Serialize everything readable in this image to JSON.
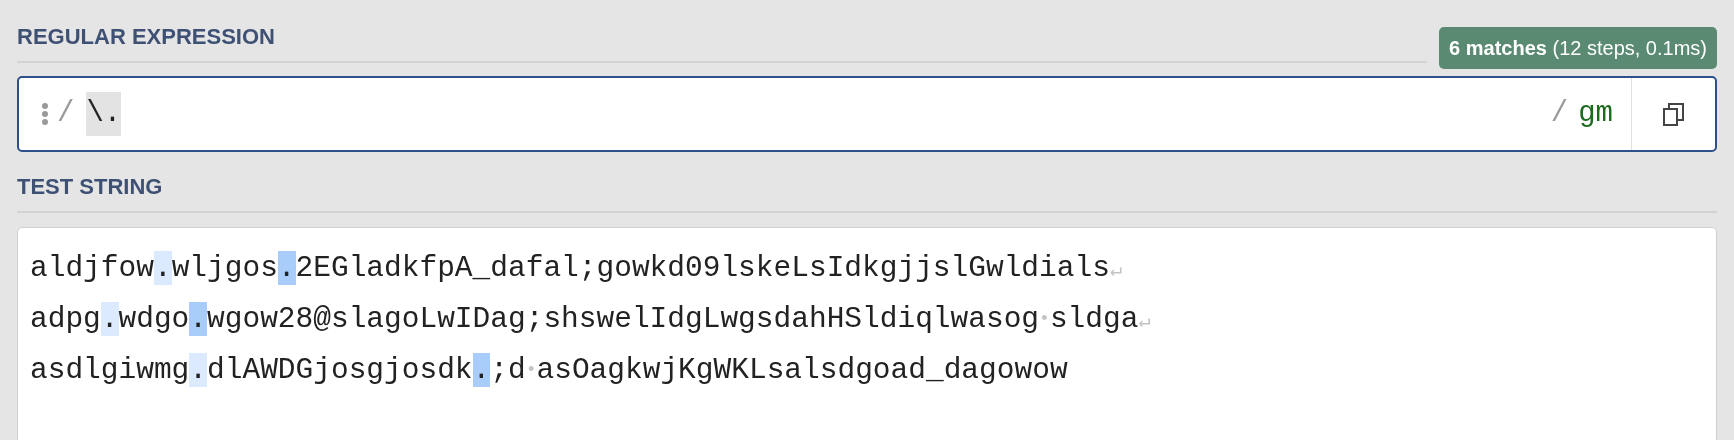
{
  "regex": {
    "heading": "REGULAR EXPRESSION",
    "badge": {
      "bold": "6 matches",
      "detail": "(12 steps, 0.1ms)"
    },
    "open_delimiter": "/",
    "pattern": "\\.",
    "close_delimiter": "/",
    "flags": "gm"
  },
  "test_string": {
    "heading": "TEST STRING",
    "lines": [
      [
        {
          "kind": "text",
          "text": "aldjfow"
        },
        {
          "kind": "match",
          "text": ".",
          "color": "#dbeafe"
        },
        {
          "kind": "text",
          "text": "wljgos"
        },
        {
          "kind": "match",
          "text": ".",
          "color": "#a8cdfa"
        },
        {
          "kind": "text",
          "text": "2EGladkfpA_dafal;gowkd09lskeLsIdkgjjslGwldials"
        },
        {
          "kind": "eol",
          "text": "↵"
        }
      ],
      [
        {
          "kind": "text",
          "text": "adpg"
        },
        {
          "kind": "match",
          "text": ".",
          "color": "#dbeafe"
        },
        {
          "kind": "text",
          "text": "wdgo"
        },
        {
          "kind": "match",
          "text": ".",
          "color": "#a8cdfa"
        },
        {
          "kind": "text",
          "text": "wgow28@slagoLwIDag;shswelIdgLwgsdahHSldiqlwasog"
        },
        {
          "kind": "space",
          "text": "•"
        },
        {
          "kind": "text",
          "text": "sldga"
        },
        {
          "kind": "eol",
          "text": "↵"
        }
      ],
      [
        {
          "kind": "text",
          "text": "asdlgiwmg"
        },
        {
          "kind": "match",
          "text": ".",
          "color": "#dbeafe"
        },
        {
          "kind": "text",
          "text": "dlAWDGjosgjosdk"
        },
        {
          "kind": "match",
          "text": ".",
          "color": "#a8cdfa"
        },
        {
          "kind": "text",
          "text": ";d"
        },
        {
          "kind": "space",
          "text": "•"
        },
        {
          "kind": "text",
          "text": "asOagkwjKgWKLsalsdgoad_dagowow"
        }
      ]
    ]
  }
}
